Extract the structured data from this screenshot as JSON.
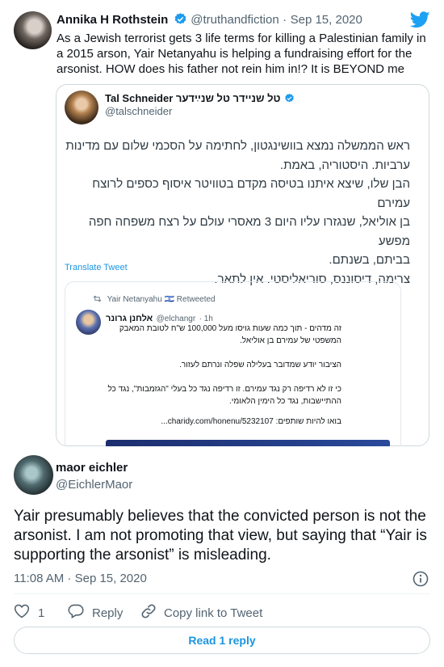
{
  "parent_tweet": {
    "author_name": "Annika H Rothstein",
    "author_handle": "@truthandfiction",
    "sep": "·",
    "date": "Sep 15, 2020",
    "text": "As a Jewish terrorist gets 3 life terms for killing a Palestinian family in a 2015 arson, Yair Netanyahu is helping a fundraising effort for the arsonist. HOW does his father not rein him in!? It is BEYOND me"
  },
  "quoted_tweet": {
    "author_name": "Tal Schneider טל שניידר טל שנײַדער",
    "author_handle": "@talschneider",
    "text_lines": [
      "ראש הממשלה נמצא בוושינגטון, לחתימה על הסכמי שלום עם מדינות",
      "ערביות. היסטוריה, באמת.",
      "הבן שלו, שיצא איתנו בטיסה מקדם בטוויטר איסוף כספים לרוצח עמירם",
      "בן אוליאל, שנגזרו עליו היום 3 מאסרי עולם על רצח משפחה חפה מפשע",
      "בביתם, בשנתם.",
      "צרימה, דיסוננס, סוריאליסטי. אין לתאר."
    ],
    "translate_label": "Translate Tweet"
  },
  "retweet_card": {
    "retweeted_by": "Yair Netanyahu 🇮🇱 Retweeted",
    "author_name": "אלחנן גרונר",
    "author_handle": "@elchangr",
    "time": "· 1h",
    "lines": [
      "זה מדהים - תוך כמה שעות גויסו מעל 100,000 ש\"ח לטובת המאבק",
      "המשפטי של עמירם בן אוליאל.",
      "הציבור יודע שמדובר בעלילה שפלה ונרתם לעזור.",
      "כי זו לא רדיפה רק נגד עמירם. זו רדיפה נגד כל בעלי \"הגזמבות\", נגד כל",
      "ההתיישבות, נגד כל הימין הלאומי.",
      "בואו להיות שותפים: charidy.com/honenu/5232107..."
    ]
  },
  "reply_tweet": {
    "author_name": "maor eichler",
    "author_handle": "@EichlerMaor",
    "text": "Yair presumably believes that the convicted person is not the arsonist. I am not promoting that view, but saying that “Yair is supporting the arsonist” is misleading.",
    "timestamp": "11:08 AM · Sep 15, 2020"
  },
  "actions": {
    "like_count": "1",
    "reply_label": "Reply",
    "copy_link_label": "Copy link to Tweet",
    "read_reply_label": "Read 1 reply"
  },
  "colors": {
    "twitter_blue": "#1da1f2",
    "link_blue": "#1b95e0",
    "verified_blue": "#1d9bf0",
    "border": "#cfd9de",
    "muted_text": "#536471"
  },
  "icons": [
    "twitter-logo-icon",
    "verified-badge-icon",
    "retweet-icon",
    "info-icon",
    "heart-icon",
    "reply-icon",
    "link-icon"
  ]
}
